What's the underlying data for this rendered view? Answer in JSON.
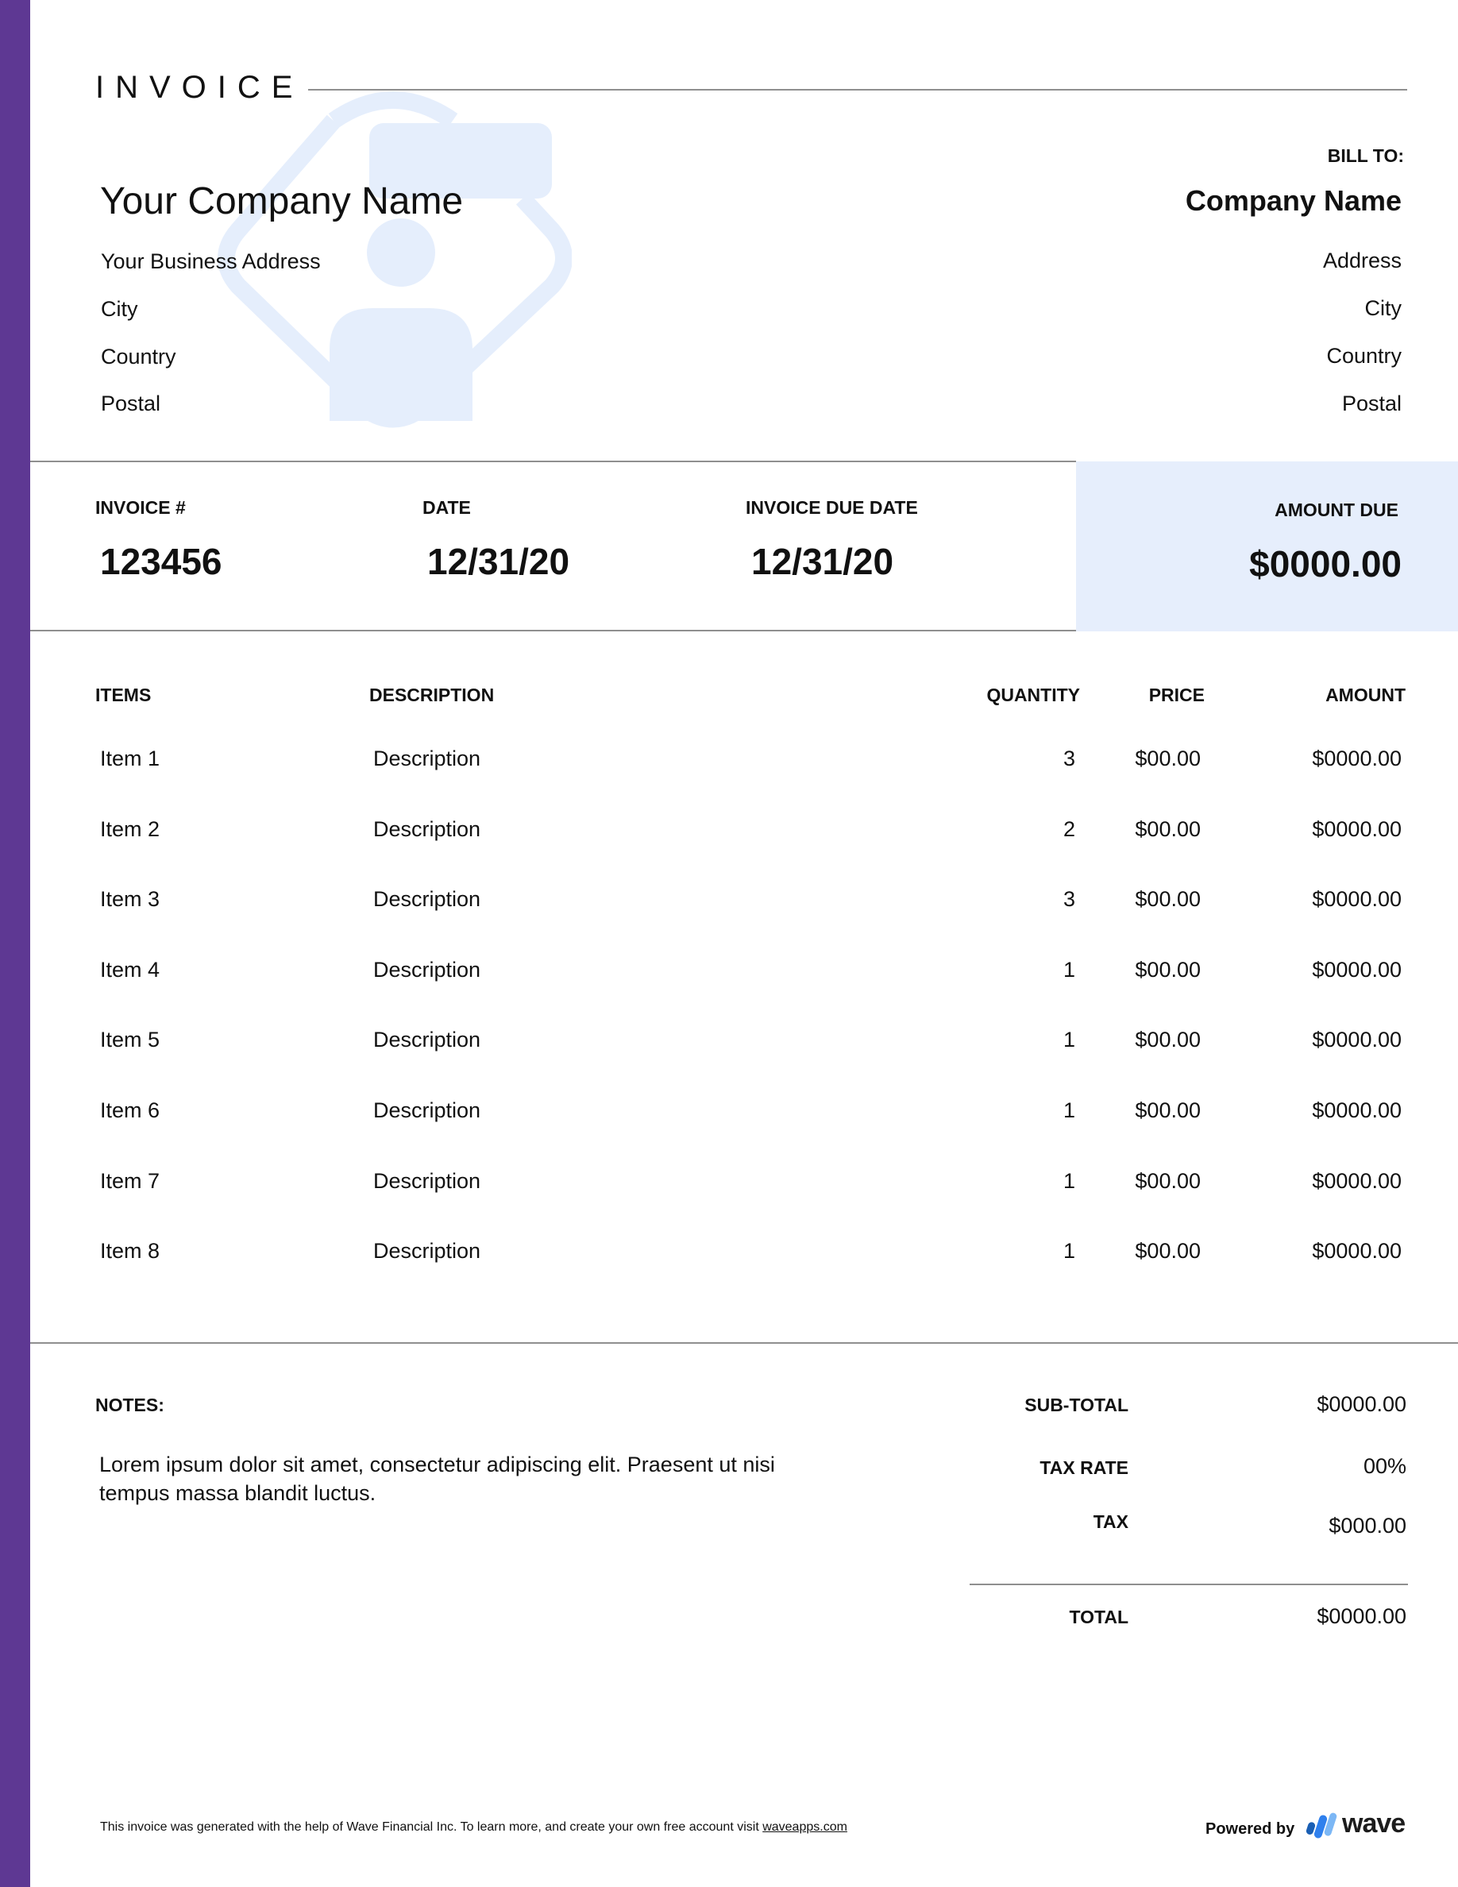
{
  "document": {
    "title": "INVOICE"
  },
  "sender": {
    "company_name": "Your Company Name",
    "address": "Your Business Address",
    "city": "City",
    "country": "Country",
    "postal": "Postal",
    "logo_icon": "user-placeholder-logo-icon"
  },
  "bill_to": {
    "label": "BILL TO:",
    "company_name": "Company Name",
    "address": "Address",
    "city": "City",
    "country": "Country",
    "postal": "Postal"
  },
  "meta": {
    "invoice_number_label": "INVOICE #",
    "invoice_number": "123456",
    "date_label": "DATE",
    "date": "12/31/20",
    "due_date_label": "INVOICE DUE DATE",
    "due_date": "12/31/20",
    "amount_due_label": "AMOUNT DUE",
    "amount_due": "$0000.00"
  },
  "table": {
    "headers": {
      "items": "ITEMS",
      "description": "DESCRIPTION",
      "quantity": "QUANTITY",
      "price": "PRICE",
      "amount": "AMOUNT"
    },
    "rows": [
      {
        "item": "Item 1",
        "description": "Description",
        "quantity": "3",
        "price": "$00.00",
        "amount": "$0000.00"
      },
      {
        "item": "Item 2",
        "description": "Description",
        "quantity": "2",
        "price": "$00.00",
        "amount": "$0000.00"
      },
      {
        "item": "Item 3",
        "description": "Description",
        "quantity": "3",
        "price": "$00.00",
        "amount": "$0000.00"
      },
      {
        "item": "Item 4",
        "description": "Description",
        "quantity": "1",
        "price": "$00.00",
        "amount": "$0000.00"
      },
      {
        "item": "Item 5",
        "description": "Description",
        "quantity": "1",
        "price": "$00.00",
        "amount": "$0000.00"
      },
      {
        "item": "Item 6",
        "description": "Description",
        "quantity": "1",
        "price": "$00.00",
        "amount": "$0000.00"
      },
      {
        "item": "Item 7",
        "description": "Description",
        "quantity": "1",
        "price": "$00.00",
        "amount": "$0000.00"
      },
      {
        "item": "Item 8",
        "description": "Description",
        "quantity": "1",
        "price": "$00.00",
        "amount": "$0000.00"
      }
    ]
  },
  "notes": {
    "label": "NOTES:",
    "text": "Lorem ipsum dolor sit amet, consectetur adipiscing elit. Praesent ut nisi tempus massa blandit luctus."
  },
  "totals": {
    "subtotal_label": "SUB-TOTAL",
    "subtotal": "$0000.00",
    "tax_rate_label": "TAX RATE",
    "tax_rate": "00%",
    "tax_label": "TAX",
    "tax": "$000.00",
    "total_label": "TOTAL",
    "total": "$0000.00"
  },
  "footer": {
    "text": "This invoice was generated with the help of Wave Financial Inc. To learn more, and create your own free account visit ",
    "link_text": "waveapps.com",
    "powered_by": "Powered by",
    "brand": "wave"
  },
  "colors": {
    "accent_stripe": "#5e3893",
    "amount_due_bg": "#e6eefc",
    "divider": "#8f8f8f",
    "logo_placeholder": "#e5eefc",
    "wave_blue_dark": "#1a5fb4",
    "wave_blue": "#2f80ed",
    "wave_blue_light": "#7cb7f5"
  }
}
